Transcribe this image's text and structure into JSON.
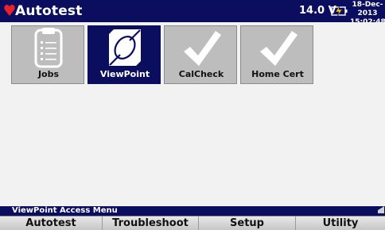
{
  "header": {
    "title": "Autotest",
    "voltage": "14.0 V",
    "date": "18-Dec-2013",
    "time": "15:02:48"
  },
  "tiles": [
    {
      "label": "Jobs",
      "icon": "clipboard-icon",
      "selected": false
    },
    {
      "label": "ViewPoint",
      "icon": "viewpoint-icon",
      "selected": true
    },
    {
      "label": "CalCheck",
      "icon": "checkmark-icon",
      "selected": false
    },
    {
      "label": "Home Cert",
      "icon": "checkmark-icon",
      "selected": false
    }
  ],
  "status": {
    "text": "ViewPoint Access Menu"
  },
  "menu": [
    {
      "label": "Autotest"
    },
    {
      "label": "Troubleshoot"
    },
    {
      "label": "Setup"
    },
    {
      "label": "Utility"
    }
  ],
  "colors": {
    "bar": "#0b0e5e",
    "tile": "#bdbdbd",
    "tile_selected": "#0b0e5e",
    "heart": "#e8232a"
  }
}
